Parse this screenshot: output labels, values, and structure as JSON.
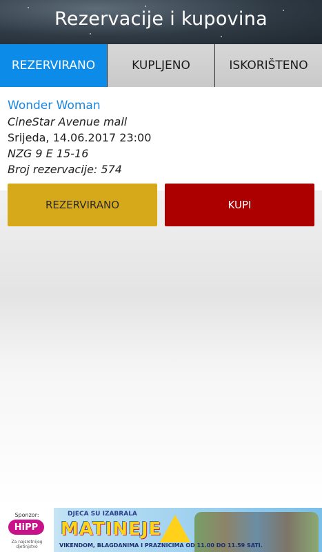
{
  "header": {
    "title": "Rezervacije i kupovina"
  },
  "tabs": [
    {
      "label": "REZERVIRANO",
      "active": true
    },
    {
      "label": "KUPLJENO",
      "active": false
    },
    {
      "label": "ISKORIŠTENO",
      "active": false
    }
  ],
  "reservation": {
    "movie": "Wonder Woman",
    "cinema": "CineStar Avenue mall",
    "datetime": "Srijeda, 14.06.2017 23:00",
    "seats": "NZG 9 E 15-16",
    "reservation_number": "Broj rezervacije: 574",
    "reserved_label": "REZERVIRANO",
    "buy_label": "KUPI"
  },
  "ad": {
    "sponsor_label": "Sponzor:",
    "sponsor_logo": "HiPP",
    "sponsor_tagline": "Za najsretnijeg djetinjstvo",
    "top_text": "DJECA SU IZABRALA",
    "brand": "MATINEJE",
    "bottom_text": "VIKENDOM, BLAGDANIMA I PRAZNICIMA OD 11.00 DO 11.59 SATI."
  },
  "colors": {
    "accent_tab": "#0d8be8",
    "movie_link": "#1a86e0",
    "reserved_button": "#d6a91a",
    "buy_button": "#ac0000"
  }
}
